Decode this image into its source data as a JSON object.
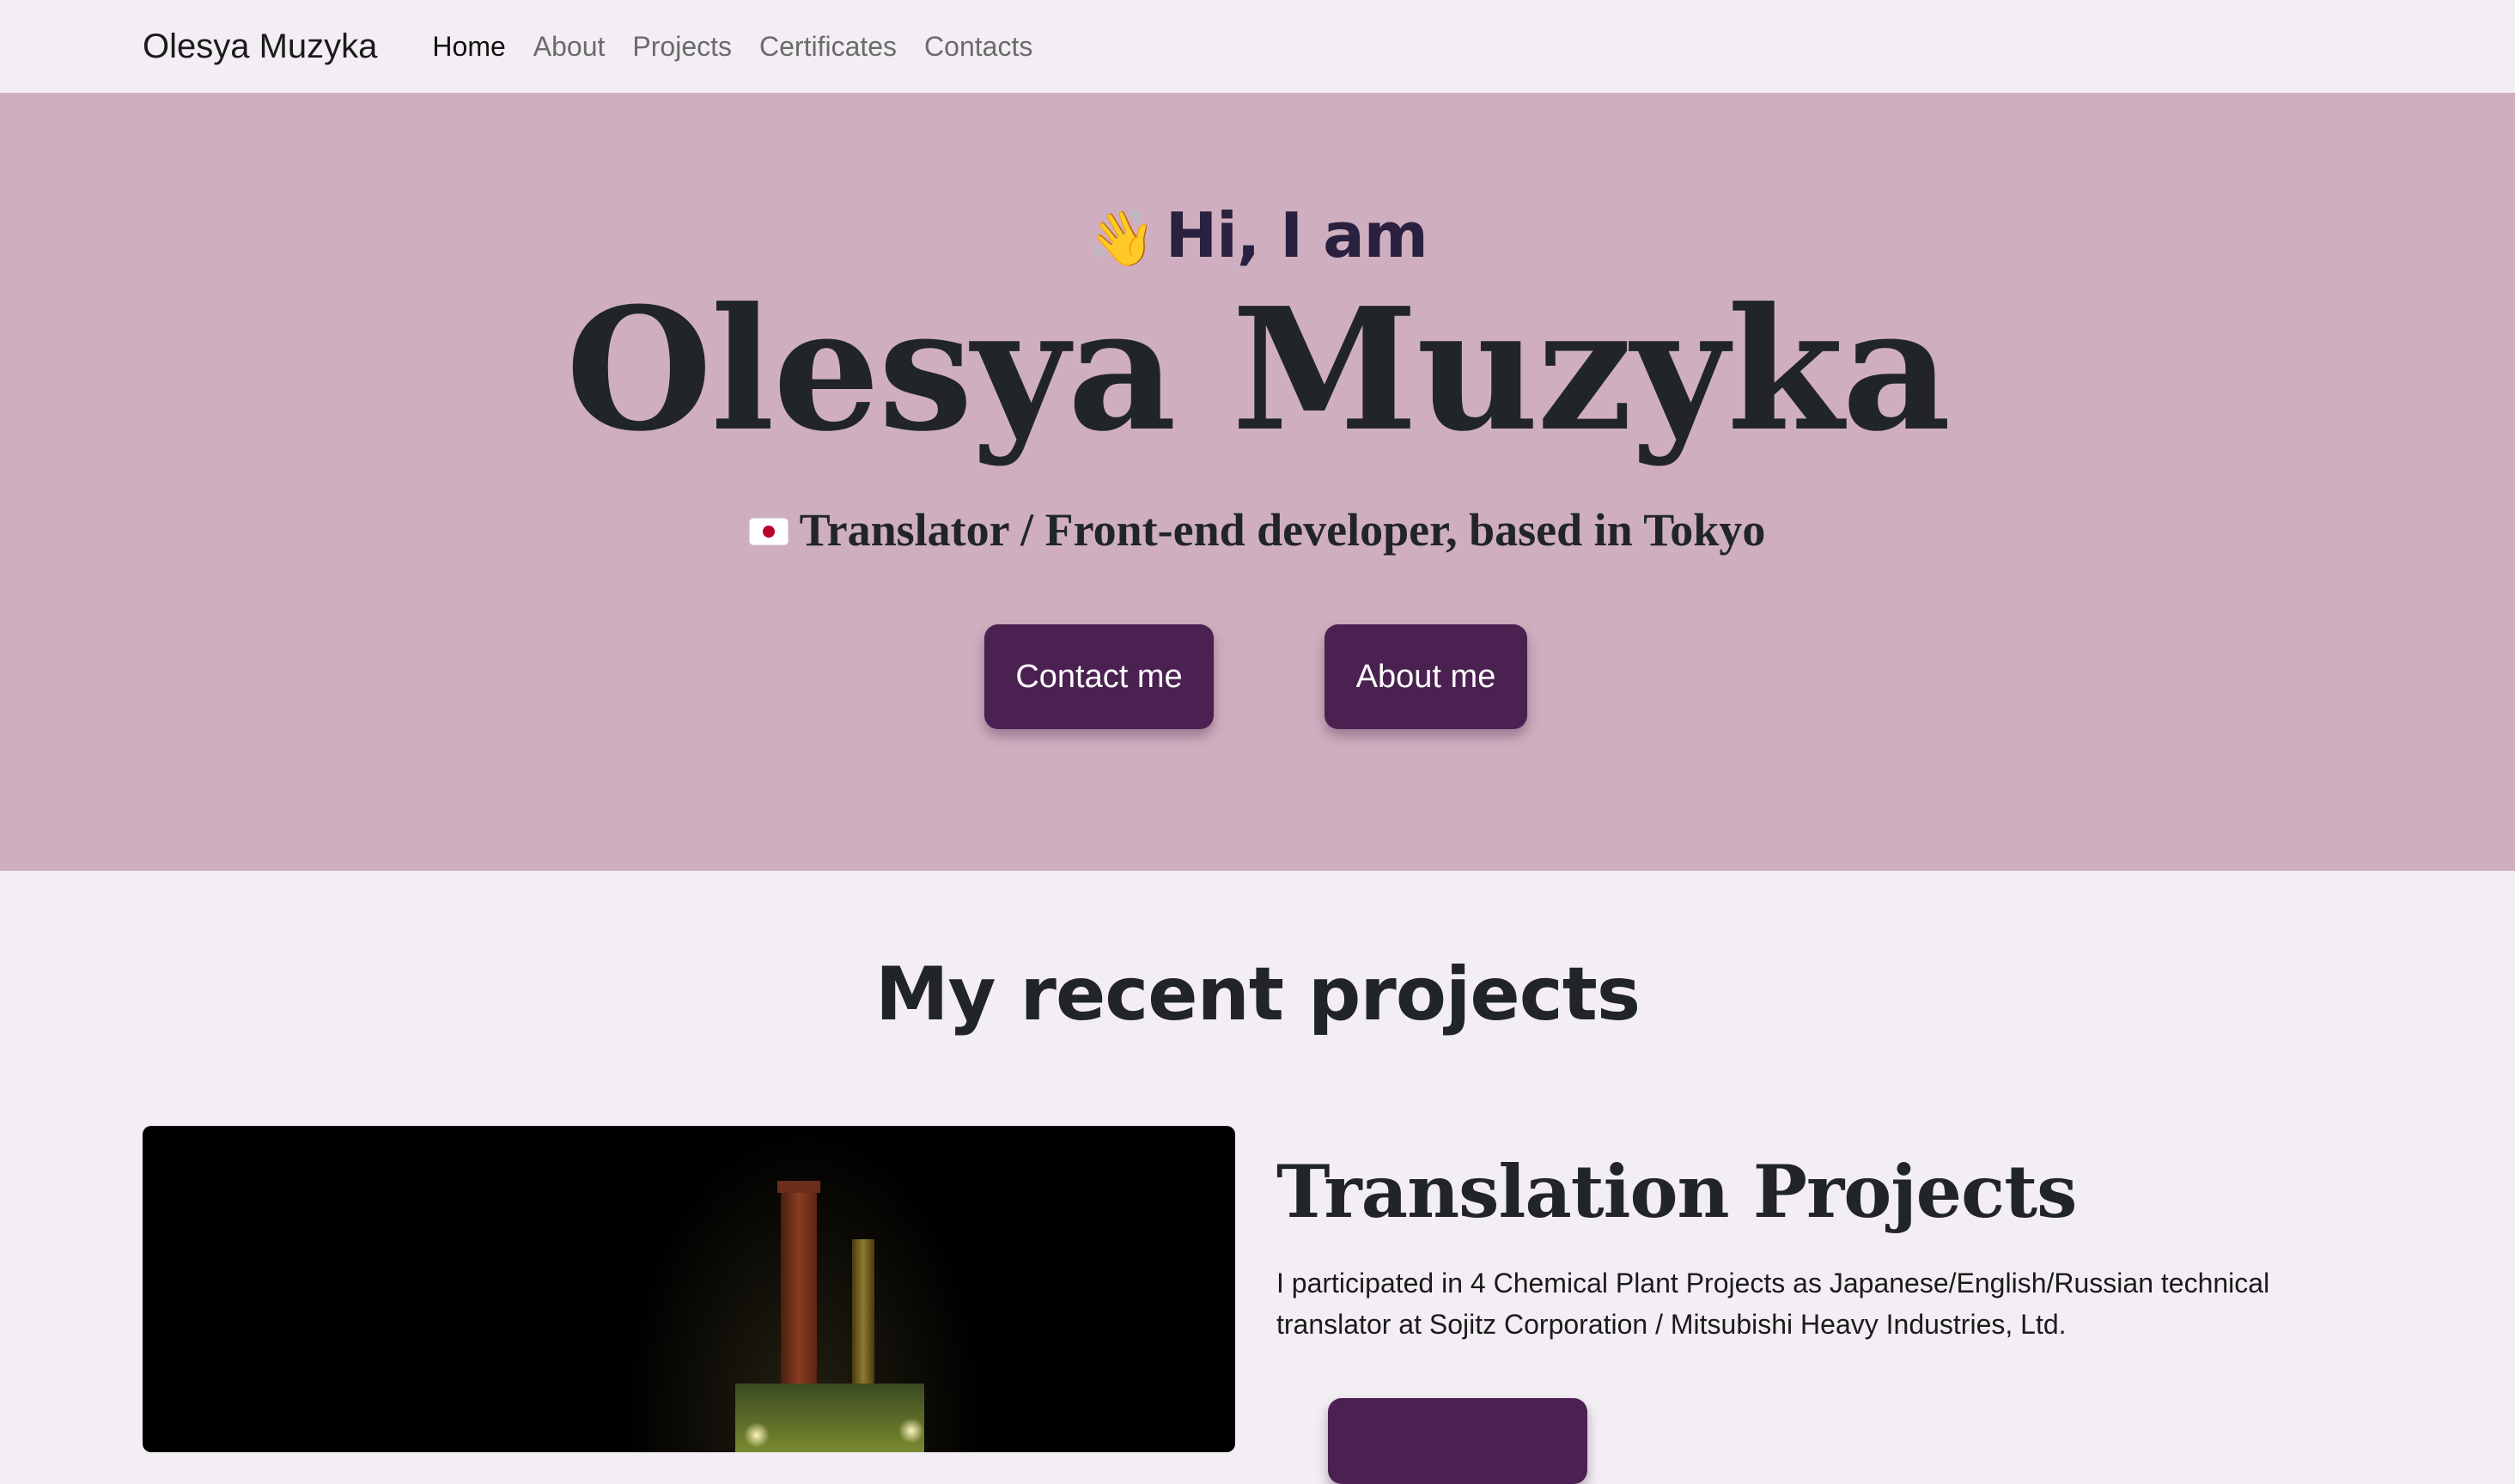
{
  "navbar": {
    "brand": "Olesya Muzyka",
    "links": [
      {
        "label": "Home",
        "active": true
      },
      {
        "label": "About",
        "active": false
      },
      {
        "label": "Projects",
        "active": false
      },
      {
        "label": "Certificates",
        "active": false
      },
      {
        "label": "Contacts",
        "active": false
      }
    ]
  },
  "hero": {
    "wave_icon": "👋",
    "greeting": "Hi, I am",
    "name": "Olesya Muzyka",
    "flag_icon": "japan-flag-icon",
    "subtitle": "Translator / Front-end developer, based in Tokyo",
    "contact_button": "Contact me",
    "about_button": "About me",
    "background_color": "#cfafbf",
    "button_color": "#4a2150"
  },
  "projects": {
    "section_title": "My recent projects",
    "items": [
      {
        "image": "factory-night-image",
        "title": "Translation Projects",
        "description": "I participated in 4 Chemical Plant Projects as Japanese/English/Russian technical translator at Sojitz Corporation / Mitsubishi Heavy Industries, Ltd."
      }
    ]
  }
}
